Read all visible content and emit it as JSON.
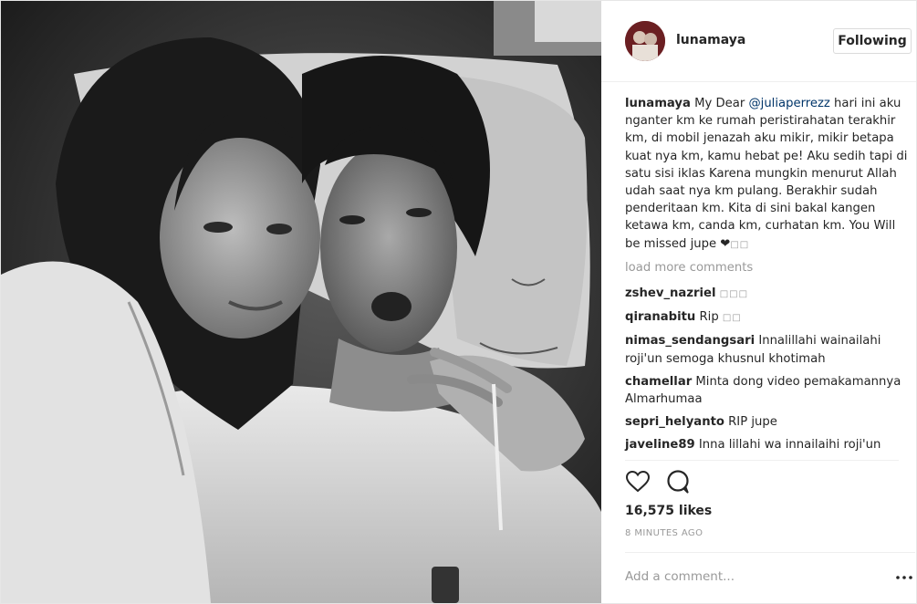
{
  "header": {
    "username": "lunamaya",
    "follow_label": "Following"
  },
  "caption": {
    "username": "lunamaya",
    "text_before": " My Dear ",
    "mention": "@juliaperrezz",
    "text_after": " hari ini aku nganter km ke rumah peristirahatan terakhir km, di mobil jenazah aku mikir, mikir betapa kuat nya km, kamu hebat pe! Aku sedih tapi di satu sisi iklas Karena mungkin menurut Allah udah saat nya km pulang. Berakhir sudah penderitaan km. Kita di sini bakal kangen ketawa km, canda km, curhatan km. You Will be missed jupe ❤",
    "trailing_glyphs": "□□"
  },
  "load_more_label": "load more comments",
  "comments": [
    {
      "username": "zshev_nazriel",
      "text": "",
      "glyphs": "□□□"
    },
    {
      "username": "qiranabitu",
      "text": " Rip",
      "glyphs": "□□"
    },
    {
      "username": "nimas_sendangsari",
      "text": " Innalillahi wainailahi roji'un semoga khusnul khotimah",
      "glyphs": ""
    },
    {
      "username": "chamellar",
      "text": " Minta dong video pemakamannya Almarhumaa",
      "glyphs": ""
    },
    {
      "username": "sepri_helyanto",
      "text": " RIP jupe",
      "glyphs": ""
    },
    {
      "username": "javeline89",
      "text": " Inna lillahi wa innailaihi roji'un",
      "glyphs": ""
    }
  ],
  "actions": {
    "like_icon": "heart-icon",
    "comment_icon": "speech-bubble-icon"
  },
  "likes": "16,575 likes",
  "timestamp": "8 MINUTES AGO",
  "add_comment_placeholder": "Add a comment...",
  "colors": {
    "text": "#262626",
    "muted": "#999999",
    "mention": "#003569",
    "border": "#efefef"
  }
}
